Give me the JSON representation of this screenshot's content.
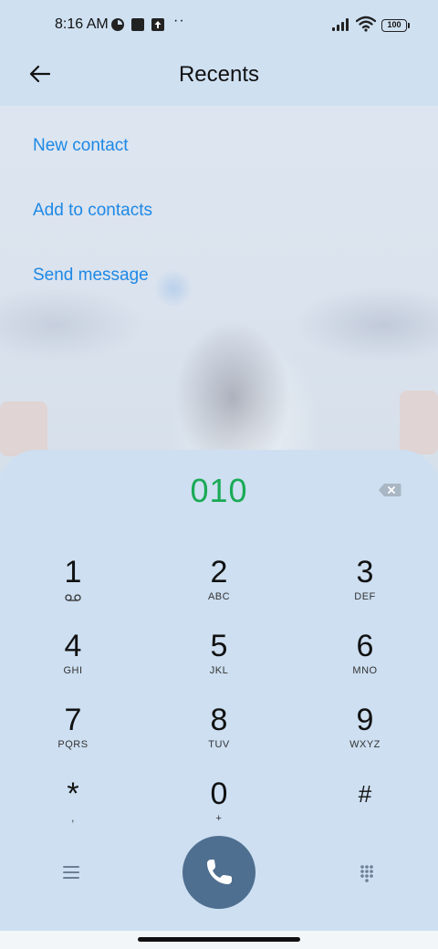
{
  "status_bar": {
    "time": "8:16 AM",
    "battery": "100",
    "icons": [
      "circle-app-icon",
      "square-app-icon",
      "upload-app-icon",
      "more-dots-icon",
      "signal-icon",
      "wifi-icon",
      "battery-icon"
    ],
    "dots": "··"
  },
  "header": {
    "title": "Recents",
    "back_icon": "back-arrow-icon"
  },
  "actions": [
    {
      "label": "New contact"
    },
    {
      "label": "Add to contacts"
    },
    {
      "label": "Send message"
    }
  ],
  "dialer": {
    "number": "010",
    "keys": [
      {
        "digit": "1",
        "letters": "voicemail-icon"
      },
      {
        "digit": "2",
        "letters": "ABC"
      },
      {
        "digit": "3",
        "letters": "DEF"
      },
      {
        "digit": "4",
        "letters": "GHI"
      },
      {
        "digit": "5",
        "letters": "JKL"
      },
      {
        "digit": "6",
        "letters": "MNO"
      },
      {
        "digit": "7",
        "letters": "PQRS"
      },
      {
        "digit": "8",
        "letters": "TUV"
      },
      {
        "digit": "9",
        "letters": "WXYZ"
      },
      {
        "digit": "*",
        "letters": ","
      },
      {
        "digit": "0",
        "letters": "+"
      },
      {
        "digit": "#",
        "letters": ""
      }
    ],
    "bottom_icons": [
      "menu-icon",
      "phone-icon",
      "dialpad-grid-icon"
    ],
    "colors": {
      "number": "#1aaa55",
      "call_button": "#4f6f90",
      "action_link": "#1e88e5"
    }
  }
}
